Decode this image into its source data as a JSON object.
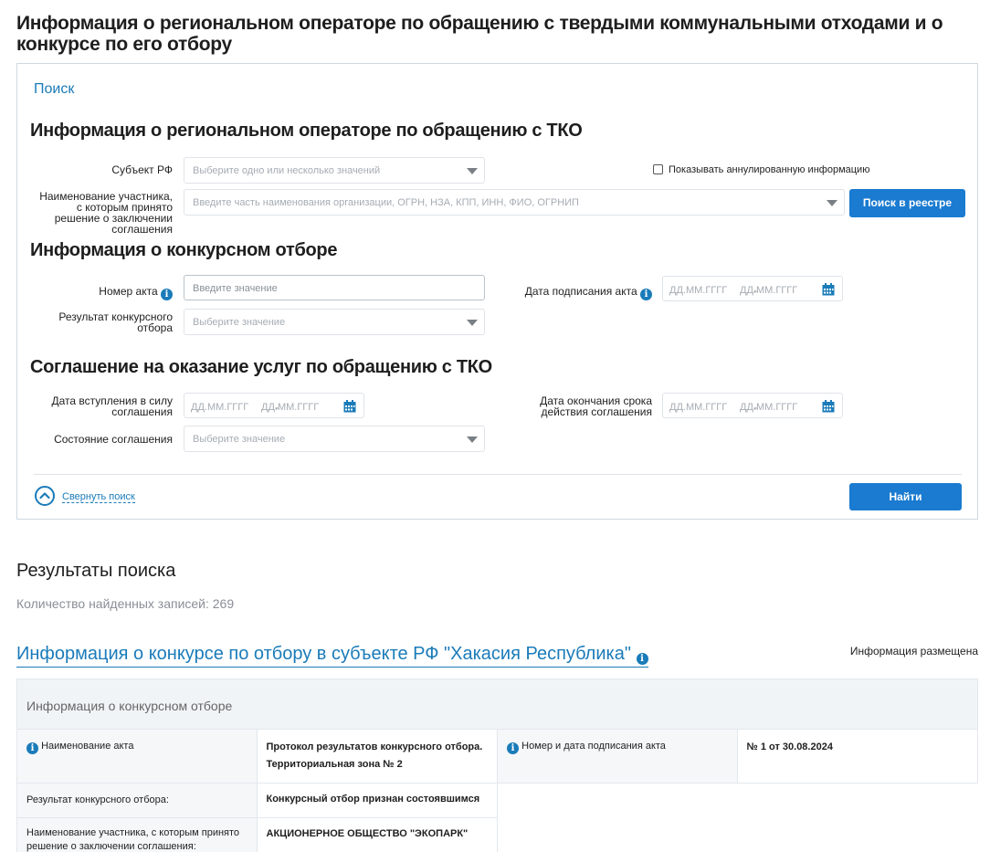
{
  "page": {
    "title": "Информация о региональном операторе по обращению с твердыми коммунальными отходами и о конкурсе по его отбору"
  },
  "search_panel": {
    "search_tab": "Поиск",
    "section_operator": "Информация о региональном операторе по обращению с ТКО",
    "subject_label": "Субъект РФ",
    "subject_placeholder": "Выберите одно или несколько значений",
    "show_annulled_label": "Показывать аннулированную информацию",
    "participant_label": "Наименование участника, с которым принято решение о заключении соглашения",
    "participant_placeholder": "Введите часть наименования организации, ОГРН, НЗА, КПП, ИНН, ФИО, ОГРНИП",
    "registry_button": "Поиск в реестре",
    "section_competition": "Информация о конкурсном отборе",
    "act_number_label": "Номер акта",
    "act_number_placeholder": "Введите значение",
    "act_date_label": "Дата подписания акта",
    "date_placeholder": "ДД.ММ.ГГГГ",
    "date_dash": "-",
    "result_label": "Результат конкурсного отбора",
    "result_placeholder": "Выберите значение",
    "section_agreement": "Соглашение на оказание услуг по обращению с ТКО",
    "effective_date_label": "Дата вступления в силу соглашения",
    "end_date_label": "Дата окончания срока действия соглашения",
    "state_label": "Состояние соглашения",
    "state_placeholder": "Выберите значение",
    "collapse_label": "Свернуть поиск",
    "find_button": "Найти"
  },
  "results": {
    "heading": "Результаты поиска",
    "count_text": "Количество найденных записей: 269",
    "item": {
      "title": "Информация о конкурсе по отбору в субъекте РФ \"Хакасия Республика\"",
      "status": "Информация размещена",
      "card_heading": "Информация о конкурсном отборе",
      "rows": {
        "act_name_label": "Наименование акта",
        "act_name_value": "Протокол результатов конкурсного отбора. Территориальная зона № 2",
        "act_num_date_label": "Номер и дата подписания акта",
        "act_num_date_value": "№ 1 от 30.08.2024",
        "result_label": "Результат конкурсного отбора:",
        "result_value": "Конкурсный отбор признан состоявшимся",
        "participant_label": "Наименование участника, с которым принято решение о заключении соглашения:",
        "participant_value": "АКЦИОНЕРНОЕ ОБЩЕСТВО \"ЭКОПАРК\""
      }
    }
  },
  "icons": {
    "info": "info-icon",
    "calendar": "calendar-icon",
    "dropdown": "chevron-down-icon",
    "collapse": "chevron-up-circle-icon"
  },
  "colors": {
    "accent": "#1a7bb9",
    "button": "#1a7bd0",
    "border": "#cfd9e2"
  }
}
